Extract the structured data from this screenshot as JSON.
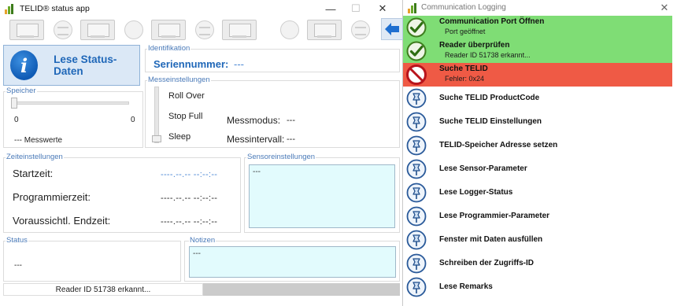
{
  "left_window": {
    "title": "TELID® status app",
    "controls": {
      "minimize": "—",
      "maximize": "☐",
      "close": "✕"
    },
    "status_button_label": "Lese Status-Daten",
    "identifikation": {
      "group": "Identifikation",
      "serial_label": "Seriennummer:",
      "serial_value": "---"
    },
    "messeinstellungen": {
      "group": "Messeinstellungen",
      "roll_over": "Roll Over",
      "stop_full": "Stop Full",
      "sleep": "Sleep",
      "messmodus_label": "Messmodus:",
      "messmodus_value": "---",
      "messintervall_label": "Messintervall:",
      "messintervall_value": "---"
    },
    "speicher": {
      "group": "Speicher",
      "min": "0",
      "max": "0",
      "messwerte": "--- Messwerte"
    },
    "zeiteinstellungen": {
      "group": "Zeiteinstellungen",
      "rows": [
        {
          "label": "Startzeit:",
          "value": "----.--.-- --:--:--"
        },
        {
          "label": "Programmierzeit:",
          "value": "----.--.-- --:--:--"
        },
        {
          "label": "Voraussichtl. Endzeit:",
          "value": "----.--.-- --:--:--"
        }
      ]
    },
    "sensoreinstellungen": {
      "group": "Sensoreinstellungen",
      "text": "---"
    },
    "status": {
      "group": "Status",
      "value": "---"
    },
    "notizen": {
      "group": "Notizen",
      "text": "---"
    },
    "statusbar_text": "Reader ID 51738 erkannt..."
  },
  "right_window": {
    "title": "Communication Logging",
    "close": "✕",
    "colors": {
      "ok": "#7fdd75",
      "error": "#ef5a45"
    },
    "entries": [
      {
        "state": "ok",
        "title": "Communication Port Öffnen",
        "sub": "Port geöffnet",
        "icon": "check-icon"
      },
      {
        "state": "ok",
        "title": "Reader überprüfen",
        "sub": "Reader ID 51738 erkannt...",
        "icon": "check-icon"
      },
      {
        "state": "error",
        "title": "Suche TELID",
        "sub": "Fehler: 0x24",
        "icon": "no-entry-icon"
      },
      {
        "state": "pending",
        "title": "Suche TELID ProductCode",
        "icon": "pin-icon"
      },
      {
        "state": "pending",
        "title": "Suche TELID Einstellungen",
        "icon": "pin-icon"
      },
      {
        "state": "pending",
        "title": "TELID-Speicher Adresse setzen",
        "icon": "pin-icon"
      },
      {
        "state": "pending",
        "title": "Lese Sensor-Parameter",
        "icon": "pin-icon"
      },
      {
        "state": "pending",
        "title": "Lese Logger-Status",
        "icon": "pin-icon"
      },
      {
        "state": "pending",
        "title": "Lese Programmier-Parameter",
        "icon": "pin-icon"
      },
      {
        "state": "pending",
        "title": "Fenster mit Daten ausfüllen",
        "icon": "pin-icon"
      },
      {
        "state": "pending",
        "title": "Schreiben der Zugriffs-ID",
        "icon": "pin-icon"
      },
      {
        "state": "pending",
        "title": "Lese Remarks",
        "icon": "pin-icon"
      }
    ]
  }
}
